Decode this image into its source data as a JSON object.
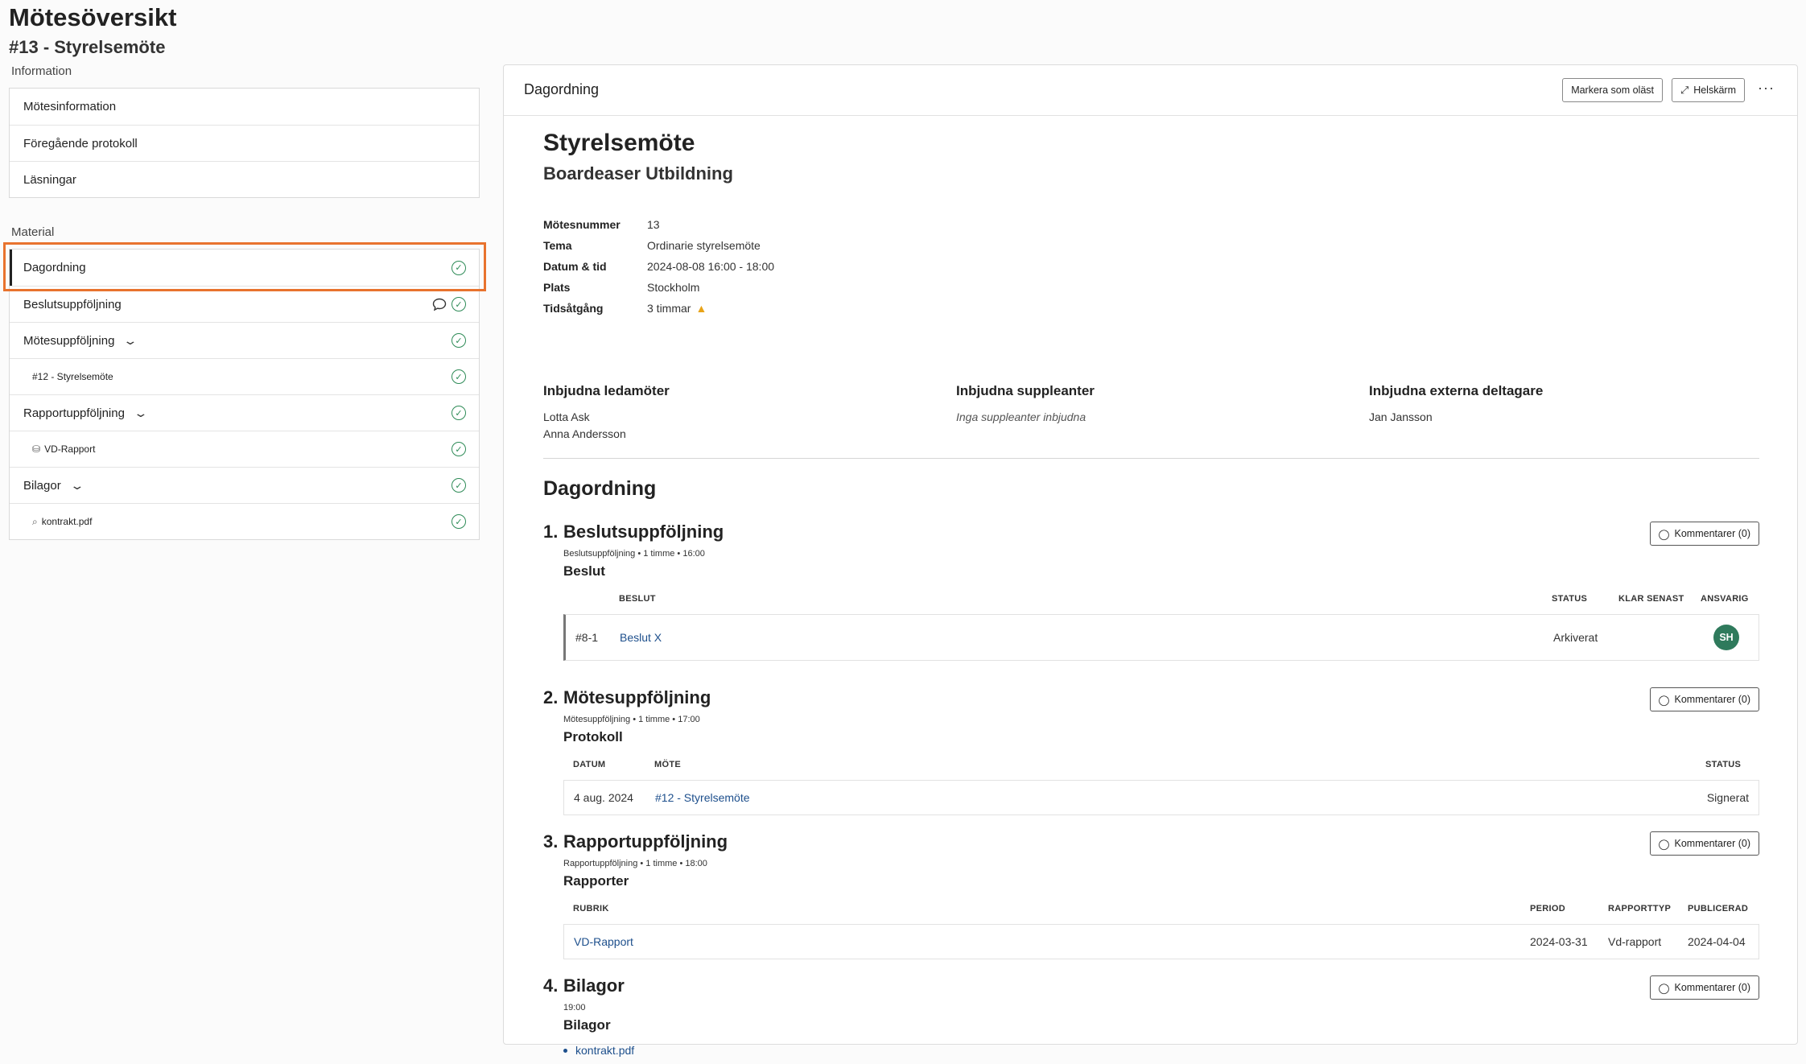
{
  "page": {
    "title": "Mötesöversikt",
    "subtitle": "#13 - Styrelsemöte"
  },
  "sidebar": {
    "info_label": "Information",
    "info_items": [
      {
        "label": "Mötesinformation"
      },
      {
        "label": "Föregående protokoll"
      },
      {
        "label": "Läsningar"
      }
    ],
    "material_label": "Material",
    "material_items": [
      {
        "label": "Dagordning"
      },
      {
        "label": "Beslutsuppföljning"
      },
      {
        "label": "Mötesuppföljning"
      },
      {
        "label": "#12 - Styrelsemöte"
      },
      {
        "label": "Rapportuppföljning"
      },
      {
        "label": "VD-Rapport"
      },
      {
        "label": "Bilagor"
      },
      {
        "label": "kontrakt.pdf"
      }
    ]
  },
  "panel": {
    "title": "Dagordning",
    "mark_unread_label": "Markera som oläst",
    "fullscreen_label": "Helskärm",
    "more_label": "···"
  },
  "document": {
    "title": "Styrelsemöte",
    "organization": "Boardeaser Utbildning",
    "meta": [
      {
        "key": "Mötesnummer",
        "value": "13"
      },
      {
        "key": "Tema",
        "value": "Ordinarie styrelsemöte"
      },
      {
        "key": "Datum & tid",
        "value": "2024-08-08 16:00 - 18:00"
      },
      {
        "key": "Plats",
        "value": "Stockholm"
      },
      {
        "key": "Tidsåtgång",
        "value": "3 timmar"
      }
    ],
    "invited_members": {
      "heading": "Inbjudna ledamöter",
      "names": [
        "Lotta Ask",
        "Anna Andersson"
      ]
    },
    "invited_deputies": {
      "heading": "Inbjudna suppleanter",
      "empty": "Inga suppleanter inbjudna"
    },
    "invited_external": {
      "heading": "Inbjudna externa deltagare",
      "names": [
        "Jan Jansson"
      ]
    }
  },
  "agenda": {
    "title": "Dagordning",
    "comment_label": "Kommentarer (0)",
    "items": [
      {
        "num": "1.",
        "title": "Beslutsuppföljning",
        "meta": "Beslutsuppföljning • 1 timme • 16:00",
        "sub": "Beslut",
        "headers": {
          "decision": "BESLUT",
          "status": "STATUS",
          "due": "KLAR SENAST",
          "owner": "ANSVARIG"
        },
        "row": {
          "id": "#8-1",
          "decision": "Beslut X",
          "status": "Arkiverat",
          "owner_initials": "SH"
        }
      },
      {
        "num": "2.",
        "title": "Mötesuppföljning",
        "meta": "Mötesuppföljning • 1 timme • 17:00",
        "sub": "Protokoll",
        "headers": {
          "date": "DATUM",
          "meeting": "MÖTE",
          "status": "STATUS"
        },
        "row": {
          "date": "4 aug. 2024",
          "meeting": "#12 - Styrelsemöte",
          "status": "Signerat"
        }
      },
      {
        "num": "3.",
        "title": "Rapportuppföljning",
        "meta": "Rapportuppföljning • 1 timme • 18:00",
        "sub": "Rapporter",
        "headers": {
          "heading": "RUBRIK",
          "period": "PERIOD",
          "type": "RAPPORTTYP",
          "published": "PUBLICERAD"
        },
        "row": {
          "heading": "VD-Rapport",
          "period": "2024-03-31",
          "type": "Vd-rapport",
          "published": "2024-04-04"
        }
      },
      {
        "num": "4.",
        "title": "Bilagor",
        "meta": "19:00",
        "sub": "Bilagor",
        "files": [
          "kontrakt.pdf"
        ]
      }
    ]
  },
  "colors": {
    "highlight": "#e8732e",
    "check": "#2e8b57",
    "link": "#1d4f8c",
    "avatar": "#2f7a5c",
    "warning": "#e8a317"
  }
}
